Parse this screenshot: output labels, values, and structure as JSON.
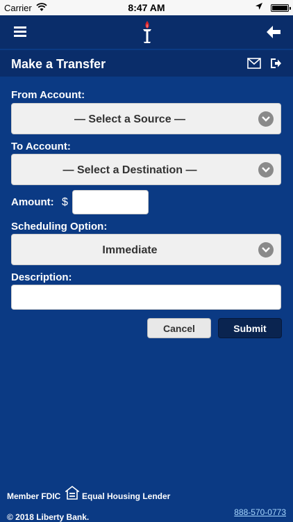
{
  "status_bar": {
    "carrier": "Carrier",
    "time": "8:47 AM",
    "icons": [
      "wifi-icon",
      "location-arrow-icon",
      "battery-icon"
    ]
  },
  "nav": {
    "menu_icon": "hamburger-menu-icon",
    "logo": "liberty-bank-torch-logo",
    "back_icon": "arrow-left-icon"
  },
  "header": {
    "title": "Make a Transfer",
    "icons": [
      "envelope-icon",
      "logout-icon"
    ]
  },
  "form": {
    "from_label": "From Account:",
    "from_value": "— Select a Source —",
    "to_label": "To Account:",
    "to_value": "— Select a Destination —",
    "amount_label": "Amount:",
    "currency_symbol": "$",
    "amount_value": "",
    "scheduling_label": "Scheduling Option:",
    "scheduling_value": "Immediate",
    "description_label": "Description:",
    "description_value": "",
    "cancel_label": "Cancel",
    "submit_label": "Submit"
  },
  "footer": {
    "member_fdic": "Member FDIC",
    "equal_housing": "Equal Housing Lender",
    "copyright": "© 2018 Liberty Bank.",
    "phone": "888-570-0773"
  },
  "colors": {
    "background": "#0b3a84",
    "nav": "#0a2d6a",
    "submit": "#0a2450",
    "phone_link": "#a8d8ff"
  }
}
